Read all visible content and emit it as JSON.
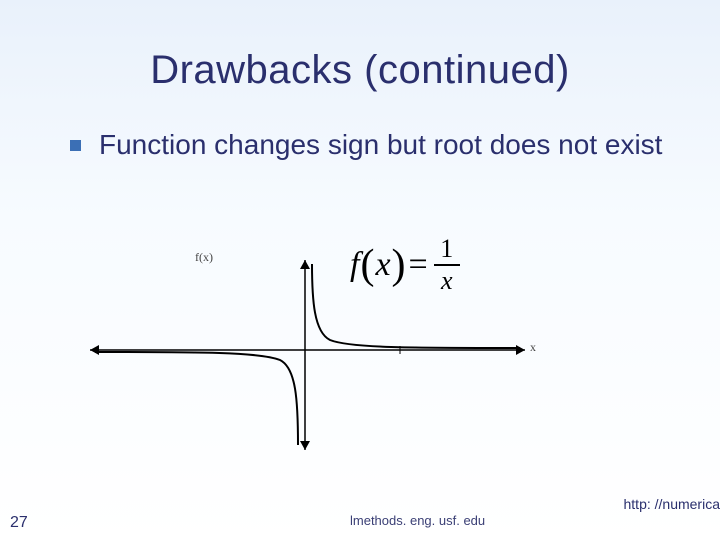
{
  "title": "Drawbacks (continued)",
  "bullet": {
    "text": "Function changes sign but root does not exist"
  },
  "figure": {
    "fx_label": "f(x)",
    "x_label": "x",
    "equation": {
      "func": "f",
      "arg": "x",
      "numerator": "1",
      "denominator": "x"
    }
  },
  "footer": {
    "page_number": "27",
    "url_right": "http: //numerica",
    "url_center": "lmethods. eng. usf. edu"
  },
  "chart_data": {
    "type": "line",
    "title": "",
    "xlabel": "x",
    "ylabel": "f(x)",
    "xlim": [
      -5,
      5
    ],
    "ylim": [
      -5,
      5
    ],
    "series": [
      {
        "name": "1/x (x>0)",
        "x": [
          0.2,
          0.3,
          0.5,
          0.8,
          1,
          1.5,
          2,
          3,
          4,
          5
        ],
        "y": [
          5,
          3.33,
          2,
          1.25,
          1,
          0.67,
          0.5,
          0.33,
          0.25,
          0.2
        ]
      },
      {
        "name": "1/x (x<0)",
        "x": [
          -5,
          -4,
          -3,
          -2,
          -1.5,
          -1,
          -0.8,
          -0.5,
          -0.3,
          -0.2
        ],
        "y": [
          -0.2,
          -0.25,
          -0.33,
          -0.5,
          -0.67,
          -1,
          -1.25,
          -2,
          -3.33,
          -5
        ]
      }
    ]
  }
}
